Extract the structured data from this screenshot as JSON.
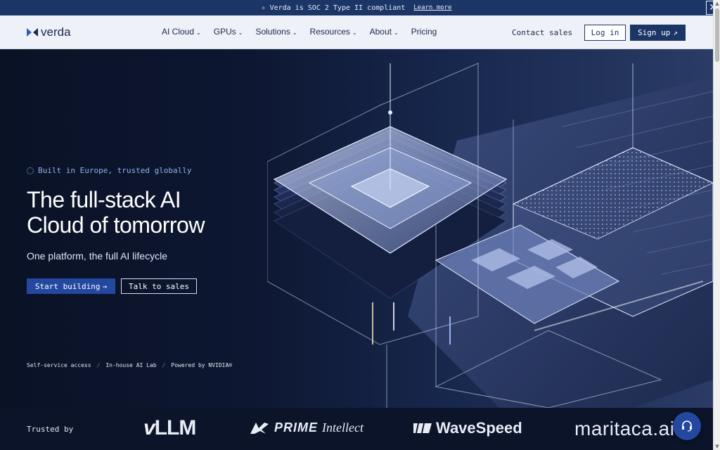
{
  "banner": {
    "text": "Verda is SOC 2 Type II compliant",
    "link": "Learn more",
    "close_glyph": "✕"
  },
  "header": {
    "logo_text": "verda",
    "nav": [
      {
        "label": "AI Cloud",
        "has_dropdown": true
      },
      {
        "label": "GPUs",
        "has_dropdown": true
      },
      {
        "label": "Solutions",
        "has_dropdown": true
      },
      {
        "label": "Resources",
        "has_dropdown": true
      },
      {
        "label": "About",
        "has_dropdown": true
      },
      {
        "label": "Pricing",
        "has_dropdown": false
      }
    ],
    "contact": "Contact sales",
    "login": "Log in",
    "signup": "Sign up",
    "signup_icon": "↗"
  },
  "hero": {
    "tag": "Built in Europe, trusted globally",
    "title_line1": "The full-stack AI",
    "title_line2": "Cloud of tomorrow",
    "subtitle": "One platform, the full AI lifecycle",
    "cta_primary": "Start building",
    "cta_primary_icon": "→",
    "cta_secondary": "Talk to sales",
    "features": [
      "Self-service access",
      "In-house AI Lab",
      "Powered by NVIDIA®"
    ],
    "feature_sep": "/"
  },
  "trusted": {
    "label": "Trusted by",
    "logos": {
      "vllm_v": "v",
      "vllm_rest": "LLM",
      "prime_a": "PRIME",
      "prime_b": "Intellect",
      "wavespeed": "WaveSpeed",
      "maritaca": "maritaca.ai"
    }
  },
  "colors": {
    "brand_navy": "#1c3567",
    "primary_blue": "#2448a0",
    "hero_bg": "#0b1428",
    "header_bg": "#eef1f7"
  },
  "icons": {
    "banner": "sparkle-icon",
    "close": "close-icon",
    "chevron": "chevron-down-icon",
    "support": "headset-icon"
  }
}
